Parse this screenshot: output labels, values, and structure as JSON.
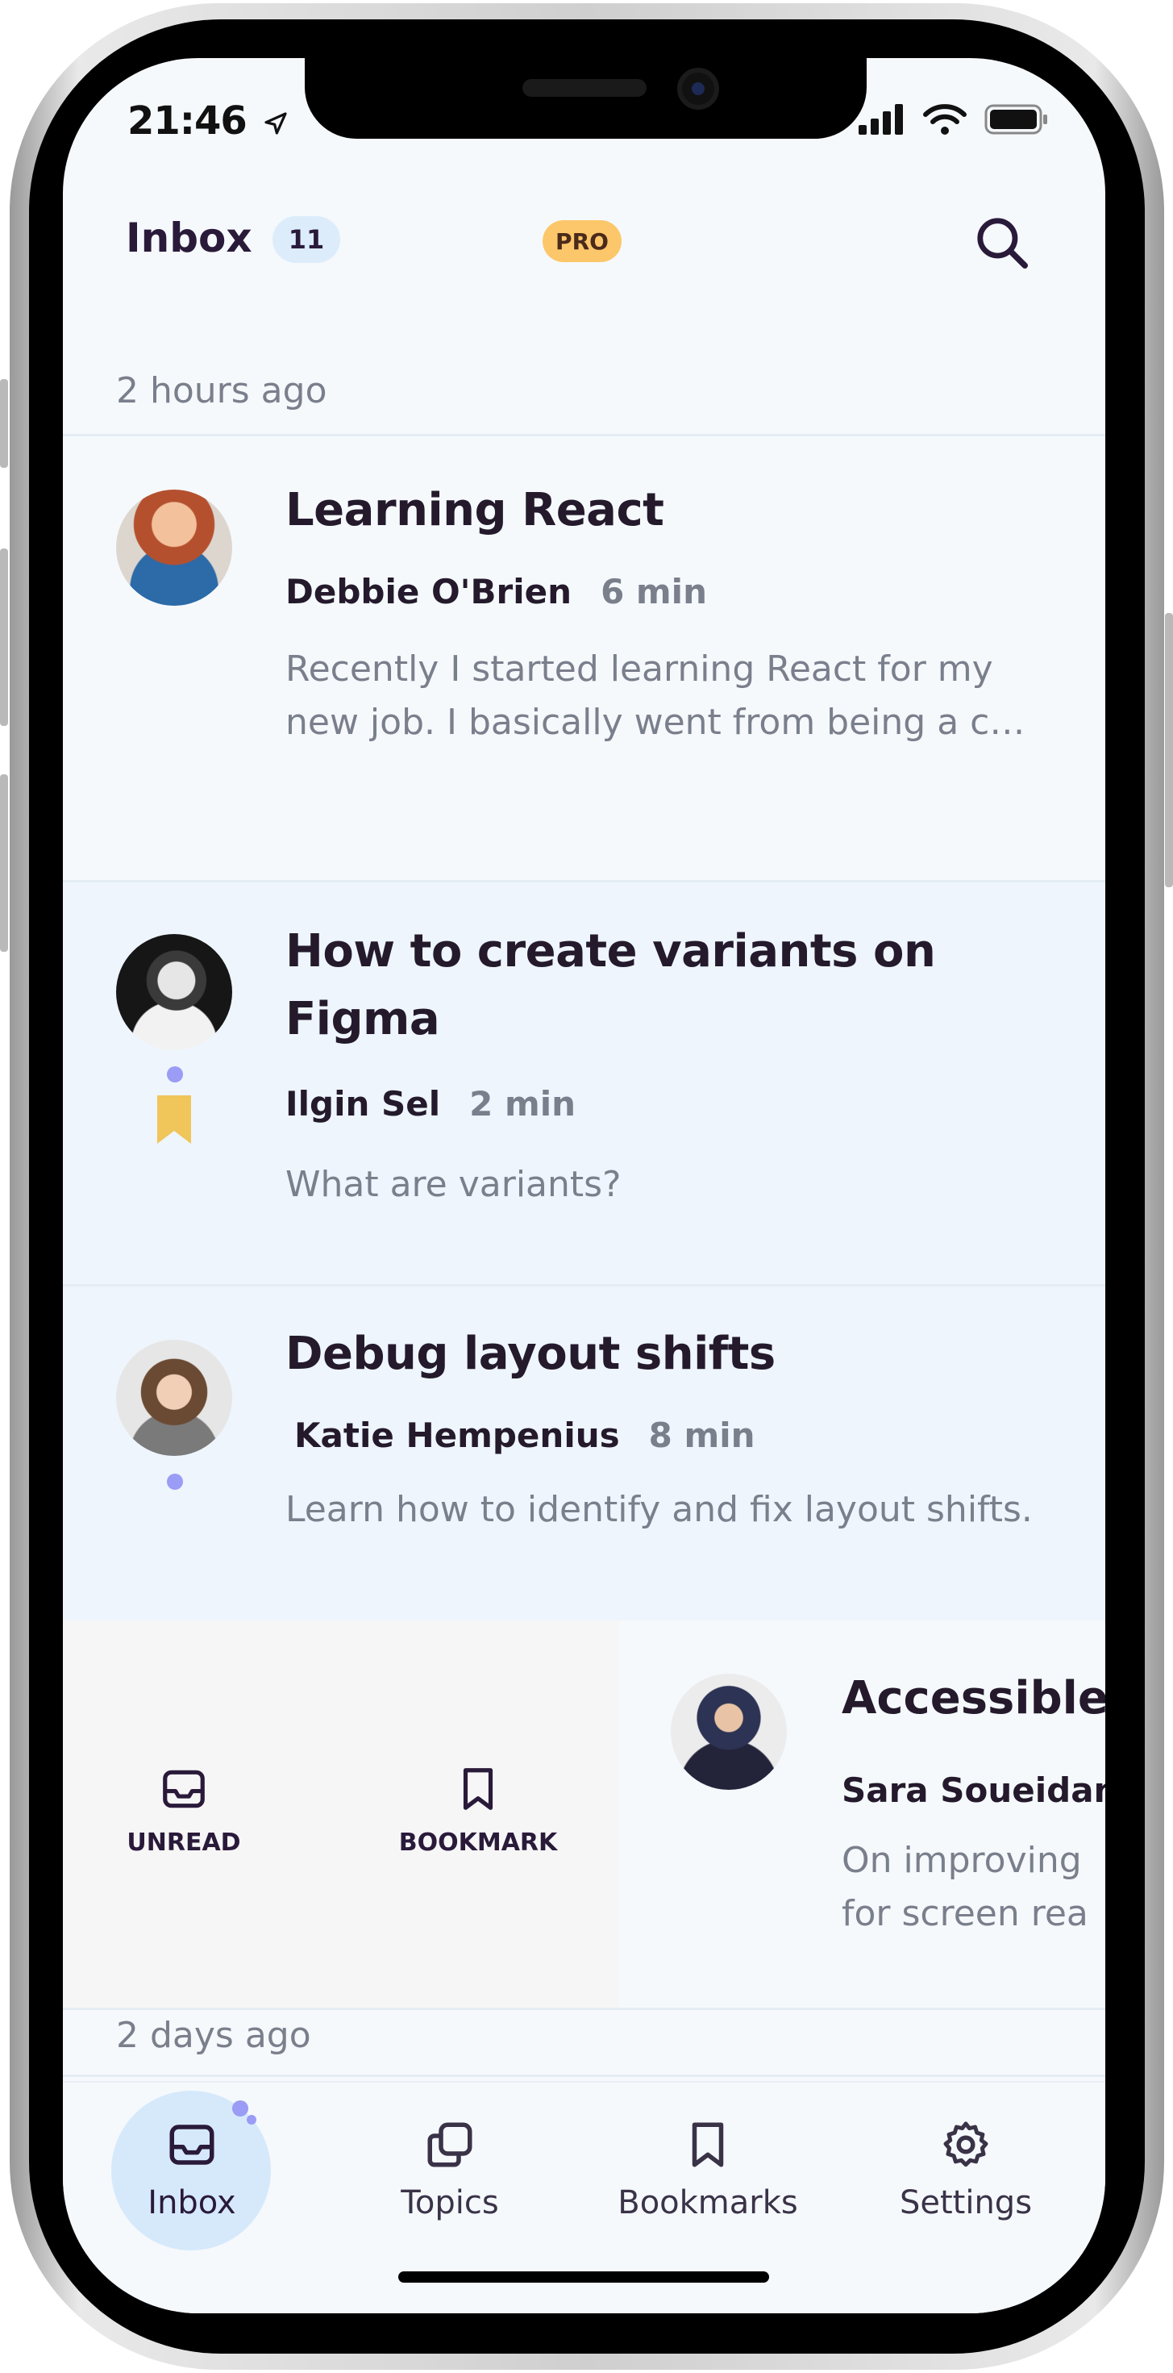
{
  "status": {
    "time": "21:46"
  },
  "header": {
    "title": "Inbox",
    "count": "11",
    "pro_label": "PRO"
  },
  "sections": [
    {
      "label": "2 hours ago"
    },
    {
      "label": "2 days ago"
    }
  ],
  "articles": [
    {
      "title": "Learning React",
      "author": "Debbie O'Brien",
      "duration": "6 min",
      "excerpt": "Recently I started learning React for my new job. I basically went from being a c…"
    },
    {
      "title": "How to create variants on Figma",
      "author": "Ilgin Sel",
      "duration": "2 min",
      "excerpt": "What are variants?"
    },
    {
      "title": "Debug layout shifts",
      "author": "Katie Hempenius",
      "duration": "8 min",
      "excerpt": "Learn how to identify and fix layout shifts."
    },
    {
      "title": "Accessible",
      "author": "Sara Soueidan",
      "duration": "",
      "excerpt_line1": "On improving",
      "excerpt_line2": "for screen rea"
    }
  ],
  "swipe_actions": {
    "unread": "UNREAD",
    "bookmark": "BOOKMARK"
  },
  "tabs": [
    {
      "label": "Inbox"
    },
    {
      "label": "Topics"
    },
    {
      "label": "Bookmarks"
    },
    {
      "label": "Settings"
    }
  ],
  "colors": {
    "accent": "#9a9cf5",
    "pro": "#fcc76a",
    "bookmark": "#f0c55a",
    "active_tab": "#d6e9fb"
  }
}
